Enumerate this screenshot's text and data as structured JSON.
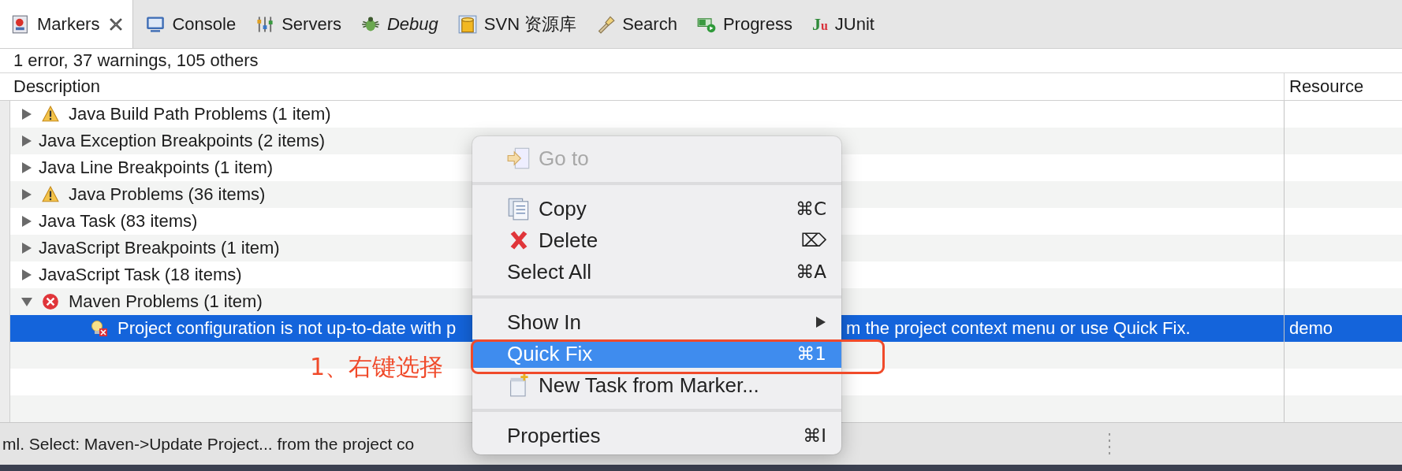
{
  "tabs": [
    {
      "label": "Markers",
      "selected": true,
      "italic": false,
      "closable": true
    },
    {
      "label": "Console",
      "selected": false,
      "italic": false,
      "closable": false
    },
    {
      "label": "Servers",
      "selected": false,
      "italic": false,
      "closable": false
    },
    {
      "label": "Debug",
      "selected": false,
      "italic": true,
      "closable": false
    },
    {
      "label": "SVN 资源库",
      "selected": false,
      "italic": false,
      "closable": false
    },
    {
      "label": "Search",
      "selected": false,
      "italic": false,
      "closable": false
    },
    {
      "label": "Progress",
      "selected": false,
      "italic": false,
      "closable": false
    },
    {
      "label": "JUnit",
      "selected": false,
      "italic": false,
      "closable": false,
      "logo": "Ju"
    }
  ],
  "summary": "1 error, 37 warnings, 105 others",
  "table": {
    "columns": [
      "Description",
      "Resource"
    ],
    "rows": [
      {
        "label": "Java Build Path Problems (1 item)",
        "warning": true,
        "error": false,
        "expanded": false,
        "selected": false
      },
      {
        "label": "Java Exception Breakpoints (2 items)",
        "warning": false,
        "error": false,
        "expanded": false,
        "selected": false
      },
      {
        "label": "Java Line Breakpoints (1 item)",
        "warning": false,
        "error": false,
        "expanded": false,
        "selected": false
      },
      {
        "label": "Java Problems (36 items)",
        "warning": true,
        "error": false,
        "expanded": false,
        "selected": false
      },
      {
        "label": "Java Task (83 items)",
        "warning": false,
        "error": false,
        "expanded": false,
        "selected": false
      },
      {
        "label": "JavaScript Breakpoints (1 item)",
        "warning": false,
        "error": false,
        "expanded": false,
        "selected": false
      },
      {
        "label": "JavaScript Task (18 items)",
        "warning": false,
        "error": false,
        "expanded": false,
        "selected": false
      },
      {
        "label": "Maven Problems (1 item)",
        "warning": false,
        "error": true,
        "expanded": true,
        "selected": false,
        "children": [
          {
            "label": "Project configuration is not up-to-date with p",
            "label_after_menu": "m the project context menu or use Quick Fix.",
            "resource": "demo",
            "warning": false,
            "error": true,
            "selected": true
          }
        ]
      }
    ]
  },
  "status_bar": {
    "text": "ml. Select: Maven->Update Project... from the project co"
  },
  "context_menu": {
    "groups": [
      [
        {
          "label": "Go to",
          "disabled": true,
          "selected": false,
          "submenu": false
        }
      ],
      [
        {
          "label": "Copy",
          "shortcut": "⌘C",
          "disabled": false,
          "selected": false,
          "submenu": false
        },
        {
          "label": "Delete",
          "shortcut": "⌦",
          "disabled": false,
          "selected": false,
          "submenu": false
        },
        {
          "label": "Select All",
          "shortcut": "⌘A",
          "disabled": false,
          "selected": false,
          "submenu": false
        }
      ],
      [
        {
          "label": "Show In",
          "submenu": true,
          "disabled": false,
          "selected": false
        },
        {
          "label": "Quick Fix",
          "shortcut": "⌘1",
          "disabled": false,
          "selected": true,
          "submenu": false
        },
        {
          "label": "New Task from Marker...",
          "disabled": false,
          "selected": false,
          "submenu": false
        }
      ],
      [
        {
          "label": "Properties",
          "shortcut": "⌘I",
          "disabled": false,
          "selected": false,
          "submenu": false
        }
      ]
    ]
  },
  "annotation": {
    "label": "1、右键选择"
  }
}
